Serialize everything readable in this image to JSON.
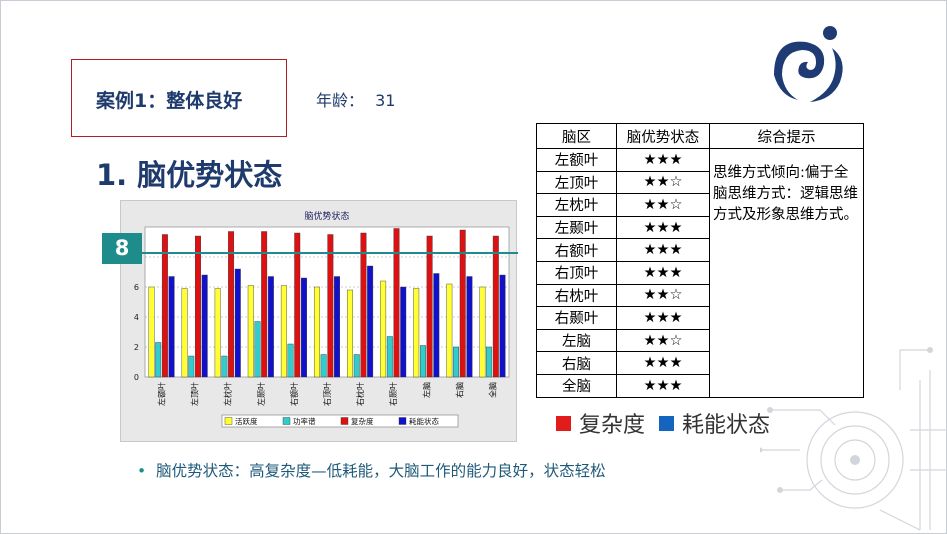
{
  "header": {
    "case_title": "案例1：整体良好",
    "age_label": "年龄：",
    "age_value": "31",
    "section_title": "1. 脑优势状态"
  },
  "badge": {
    "value": "8"
  },
  "chart_data": {
    "type": "bar",
    "title": "脑优势状态",
    "categories": [
      "左额叶",
      "左顶叶",
      "左枕叶",
      "左颞叶",
      "右额叶",
      "右顶叶",
      "右枕叶",
      "右颞叶",
      "左脑",
      "右脑",
      "全脑"
    ],
    "ylim": [
      0,
      10
    ],
    "yticks": [
      "0",
      "2",
      "4",
      "6",
      "8"
    ],
    "series": [
      {
        "name": "活跃度",
        "color": "#ffff33",
        "values": [
          6.0,
          5.9,
          5.9,
          6.1,
          6.1,
          6.0,
          5.8,
          6.4,
          5.9,
          6.2,
          6.0
        ]
      },
      {
        "name": "功率谱",
        "color": "#33cccc",
        "values": [
          2.3,
          1.4,
          1.4,
          3.7,
          2.2,
          1.5,
          1.5,
          2.7,
          2.1,
          2.0,
          2.0
        ]
      },
      {
        "name": "复杂度",
        "color": "#dd1111",
        "values": [
          9.5,
          9.4,
          9.7,
          9.7,
          9.6,
          9.5,
          9.6,
          9.9,
          9.4,
          9.8,
          9.4
        ]
      },
      {
        "name": "耗能状态",
        "color": "#1111cc",
        "values": [
          6.7,
          6.8,
          7.2,
          6.7,
          6.6,
          6.7,
          7.4,
          6.0,
          6.9,
          6.7,
          6.8
        ]
      }
    ],
    "legend_position": "bottom",
    "grid": true
  },
  "table": {
    "headers": [
      "脑区",
      "脑优势状态",
      "综合提示"
    ],
    "rows": [
      {
        "zone": "左额叶",
        "stars": "★★★"
      },
      {
        "zone": "左顶叶",
        "stars": "★★☆"
      },
      {
        "zone": "左枕叶",
        "stars": "★★☆"
      },
      {
        "zone": "左颞叶",
        "stars": "★★★"
      },
      {
        "zone": "右额叶",
        "stars": "★★★"
      },
      {
        "zone": "右顶叶",
        "stars": "★★★"
      },
      {
        "zone": "右枕叶",
        "stars": "★★☆"
      },
      {
        "zone": "右颞叶",
        "stars": "★★★"
      },
      {
        "zone": "左脑",
        "stars": "★★☆"
      },
      {
        "zone": "右脑",
        "stars": "★★★"
      },
      {
        "zone": "全脑",
        "stars": "★★★"
      }
    ],
    "tip": "思维方式倾向:偏于全脑思维方式：逻辑思维方式及形象思维方式。"
  },
  "legend2": [
    {
      "label": "复杂度",
      "color": "#e21b1b"
    },
    {
      "label": "耗能状态",
      "color": "#1565c0"
    }
  ],
  "bullet": "脑优势状态：高复杂度—低耗能，大脑工作的能力良好，状态轻松"
}
